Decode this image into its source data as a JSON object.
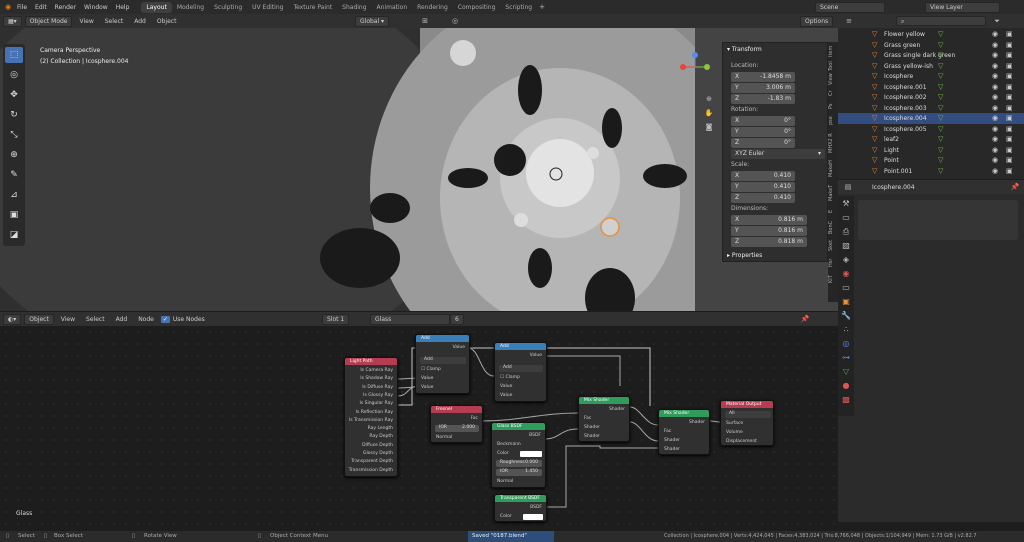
{
  "topbar": {
    "menus": [
      "File",
      "Edit",
      "Render",
      "Window",
      "Help"
    ],
    "workspaces": [
      "Layout",
      "Modeling",
      "Sculpting",
      "UV Editing",
      "Texture Paint",
      "Shading",
      "Animation",
      "Rendering",
      "Compositing",
      "Scripting"
    ],
    "active_workspace": "Layout",
    "scene_label": "Scene",
    "view_layer_label": "View Layer"
  },
  "viewport_header": {
    "mode": "Object Mode",
    "view": "View",
    "select": "Select",
    "add": "Add",
    "object": "Object",
    "orientation": "Global",
    "options": "Options"
  },
  "viewport": {
    "camera_label": "Camera Perspective",
    "collection_label": "(2) Collection | Icosphere.004"
  },
  "npanel": {
    "transform_title": "Transform",
    "location_label": "Location:",
    "location": [
      {
        "axis": "X",
        "value": "-1.8458 m"
      },
      {
        "axis": "Y",
        "value": "3.006 m"
      },
      {
        "axis": "Z",
        "value": "-1.83 m"
      }
    ],
    "rotation_label": "Rotation:",
    "rotation": [
      {
        "axis": "X",
        "value": "0°"
      },
      {
        "axis": "Y",
        "value": "0°"
      },
      {
        "axis": "Z",
        "value": "0°"
      }
    ],
    "rotation_mode": "XYZ Euler",
    "scale_label": "Scale:",
    "scale": [
      {
        "axis": "X",
        "value": "0.410"
      },
      {
        "axis": "Y",
        "value": "0.410"
      },
      {
        "axis": "Z",
        "value": "0.410"
      }
    ],
    "dimensions_label": "Dimensions:",
    "dimensions": [
      {
        "axis": "X",
        "value": "0.816 m"
      },
      {
        "axis": "Y",
        "value": "0.816 m"
      },
      {
        "axis": "Z",
        "value": "0.818 m"
      }
    ],
    "properties_title": "Properties",
    "tabs": [
      "Item",
      "Tool",
      "View",
      "Cr",
      "Ps",
      "pse",
      "MHX2 R",
      "MakeH",
      "MakeT",
      "E",
      "BonC",
      "Sket",
      "Hsr",
      "KIT"
    ]
  },
  "outliner": {
    "items": [
      {
        "name": "Flower yellow",
        "selected": false
      },
      {
        "name": "Grass green",
        "selected": false
      },
      {
        "name": "Grass single dark green",
        "selected": false
      },
      {
        "name": "Grass yellow-ish",
        "selected": false
      },
      {
        "name": "Icosphere",
        "selected": false
      },
      {
        "name": "Icosphere.001",
        "selected": false
      },
      {
        "name": "Icosphere.002",
        "selected": false
      },
      {
        "name": "Icosphere.003",
        "selected": false
      },
      {
        "name": "Icosphere.004",
        "selected": true
      },
      {
        "name": "Icosphere.005",
        "selected": false
      },
      {
        "name": "leaf2",
        "selected": false
      },
      {
        "name": "Light",
        "selected": false
      },
      {
        "name": "Point",
        "selected": false
      },
      {
        "name": "Point.001",
        "selected": false
      }
    ]
  },
  "properties": {
    "object_name": "Icosphere.004"
  },
  "node_header": {
    "type": "Object",
    "view": "View",
    "select": "Select",
    "add": "Add",
    "node": "Node",
    "use_nodes": "Use Nodes",
    "slot": "Slot 1",
    "material": "Glass",
    "users": "6"
  },
  "node_editor": {
    "material_label": "Glass",
    "nodes": {
      "light_path": {
        "title": "Light Path",
        "outputs": [
          "Is Camera Ray",
          "Is Shadow Ray",
          "Is Diffuse Ray",
          "Is Glossy Ray",
          "Is Singular Ray",
          "Is Reflection Ray",
          "Is Transmission Ray",
          "Ray Length",
          "Ray Depth",
          "Diffuse Depth",
          "Glossy Depth",
          "Transparent Depth",
          "Transmission Depth"
        ]
      },
      "add1": {
        "title": "Add",
        "output": "Value",
        "operation": "Add",
        "clamp": "Clamp",
        "in1": "Value",
        "in2": "Value"
      },
      "add2": {
        "title": "Add",
        "output": "Value",
        "operation": "Add",
        "clamp": "Clamp",
        "in1": "Value",
        "in2": "Value"
      },
      "fresnel": {
        "title": "Fresnel",
        "output": "Fac",
        "ior_label": "IOR",
        "ior_value": "2.000",
        "normal": "Normal"
      },
      "glass": {
        "title": "Glass BSDF",
        "output": "BSDF",
        "distribution": "Beckmann",
        "color": "Color",
        "roughness_label": "Roughness",
        "roughness_value": "0.000",
        "ior_label": "IOR",
        "ior_value": "1.450",
        "normal": "Normal"
      },
      "transparent": {
        "title": "Transparent BSDF",
        "output": "BSDF",
        "color": "Color"
      },
      "mix1": {
        "title": "Mix Shader",
        "output": "Shader",
        "in": [
          "Fac",
          "Shader",
          "Shader"
        ]
      },
      "mix2": {
        "title": "Mix Shader",
        "output": "Shader",
        "in": [
          "Fac",
          "Shader",
          "Shader"
        ]
      },
      "output": {
        "title": "Material Output",
        "target": "All",
        "in": [
          "Surface",
          "Volume",
          "Displacement"
        ]
      }
    }
  },
  "statusbar": {
    "select": "Select",
    "box_select": "Box Select",
    "rotate_view": "Rotate View",
    "context_menu": "Object Context Menu",
    "saved": "Saved \"0187.blend\"",
    "stats": "Collection | Icosphere.004 | Verts:4,424,045 | Faces:4,383,024 | Tris:8,766,048 | Objects:1/104,949 | Mem: 1.73 GiB | v2.82.7"
  }
}
